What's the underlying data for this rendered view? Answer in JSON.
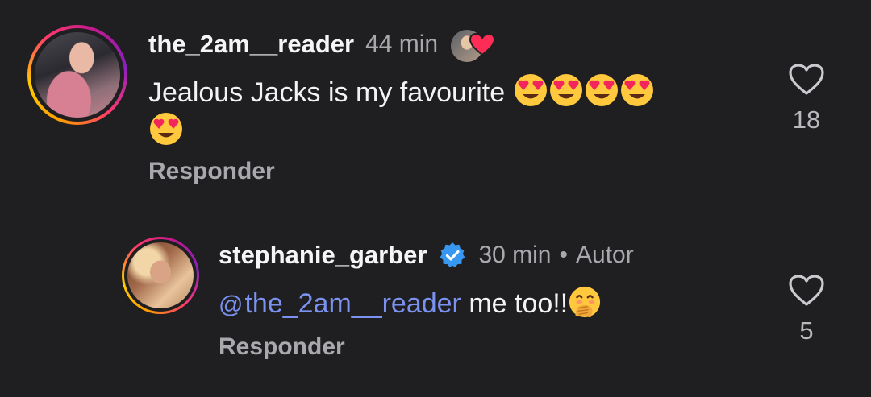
{
  "comments": [
    {
      "username": "the_2am__reader",
      "time": "44 min",
      "text": "Jealous Jacks is my favourite",
      "emoji_count": 5,
      "reply_label": "Responder",
      "likes": "18"
    },
    {
      "username": "stephanie_garber",
      "time": "30 min",
      "separator": "•",
      "author_label": "Autor",
      "mention": "the_2am__reader",
      "text": "me too!!",
      "reply_label": "Responder",
      "likes": "5"
    }
  ],
  "icons": {
    "heart_outline": "heart-icon",
    "verified": "verified-badge-icon",
    "heart_eyes": "heart-eyes-emoji",
    "hand_over_mouth": "hand-over-mouth-emoji",
    "mention_symbol": "@"
  },
  "colors": {
    "background": "#1f1f22",
    "mention": "#7b92f0",
    "verified": "#3897f0",
    "like_badge": "#ff2d55"
  }
}
